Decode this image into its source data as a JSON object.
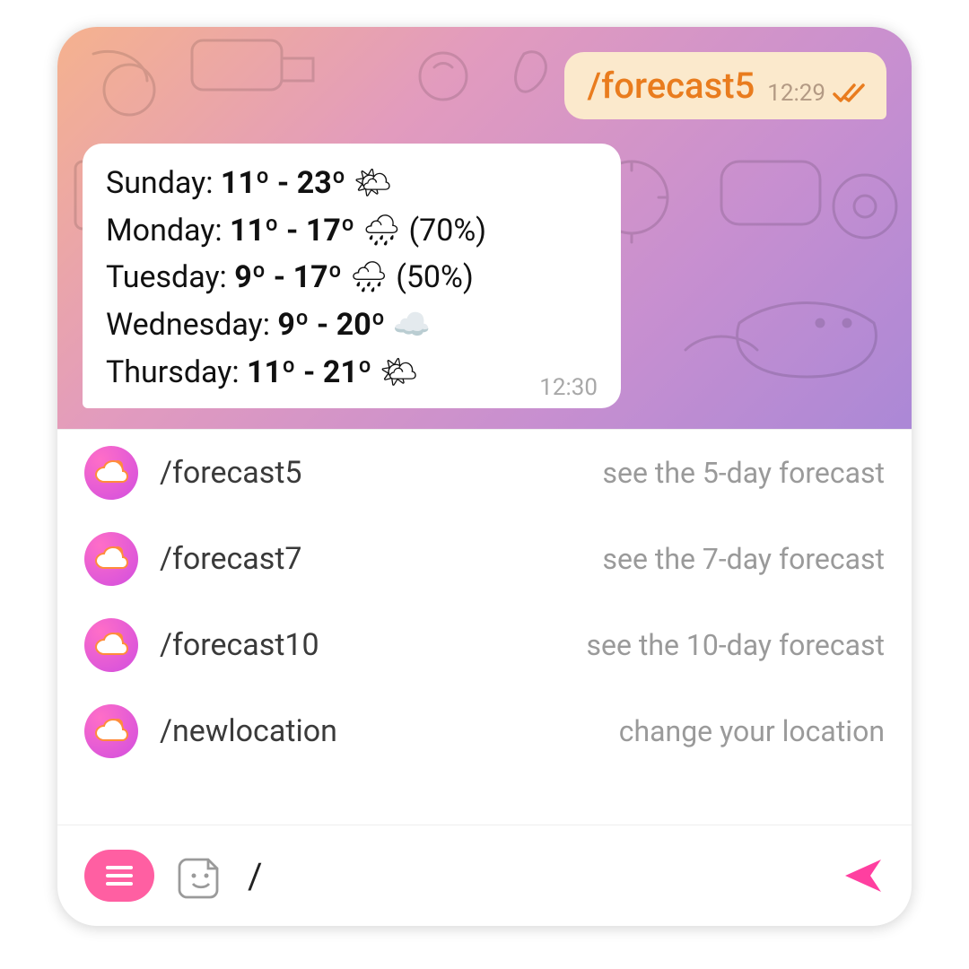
{
  "outgoing": {
    "text": "/forecast5",
    "time": "12:29"
  },
  "incoming": {
    "time": "12:30",
    "rows": [
      {
        "day": "Sunday",
        "range": "11º - 23º",
        "icon": "🌤",
        "extra": ""
      },
      {
        "day": "Monday",
        "range": "11º - 17º",
        "icon": "🌧",
        "extra": "(70%)"
      },
      {
        "day": "Tuesday",
        "range": "9º - 17º",
        "icon": "🌧",
        "extra": "(50%)"
      },
      {
        "day": "Wednesday",
        "range": "9º - 20º",
        "icon": "☁️",
        "extra": ""
      },
      {
        "day": "Thursday",
        "range": "11º - 21º",
        "icon": "🌤",
        "extra": ""
      }
    ]
  },
  "commands": [
    {
      "name": "/forecast5",
      "desc": "see the 5-day forecast"
    },
    {
      "name": "/forecast7",
      "desc": "see the 7-day forecast"
    },
    {
      "name": "/forecast10",
      "desc": "see the 10-day forecast"
    },
    {
      "name": "/newlocation",
      "desc": "change your location"
    }
  ],
  "compose": {
    "value": "/"
  }
}
